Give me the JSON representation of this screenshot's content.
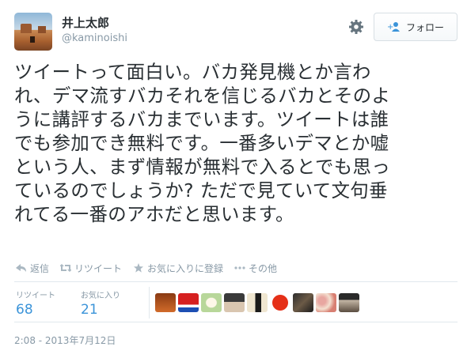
{
  "user": {
    "display_name": "井上太郎",
    "screen_name": "@kaminoishi"
  },
  "follow_button": {
    "label": "フォロー"
  },
  "tweet": {
    "lines": [
      "ツイートって面白い。バカ発見機とか言わ",
      "れ、デマ流すバカそれを信じるバカとそのよ",
      "うに講評するバカまでいます。ツイートは誰",
      "でも参加でき無料です。一番多いデマとか嘘",
      "という人、まず情報が無料で入るとでも思っ",
      "ているのでしょうか? ただで見ていて文句垂",
      "れてる一番のアホだと思います。"
    ]
  },
  "actions": {
    "reply": "返信",
    "retweet": "リツイート",
    "favorite": "お気に入りに登録",
    "more": "その他"
  },
  "stats": {
    "retweets_label": "リツイート",
    "retweets_count": "68",
    "favorites_label": "お気に入り",
    "favorites_count": "21"
  },
  "faces_icon": "retweeter-avatars",
  "timestamp": "2:08 - 2013年7月12日",
  "colors": {
    "link_blue": "#3b94d9",
    "muted": "#8899a6",
    "text": "#292f33"
  }
}
